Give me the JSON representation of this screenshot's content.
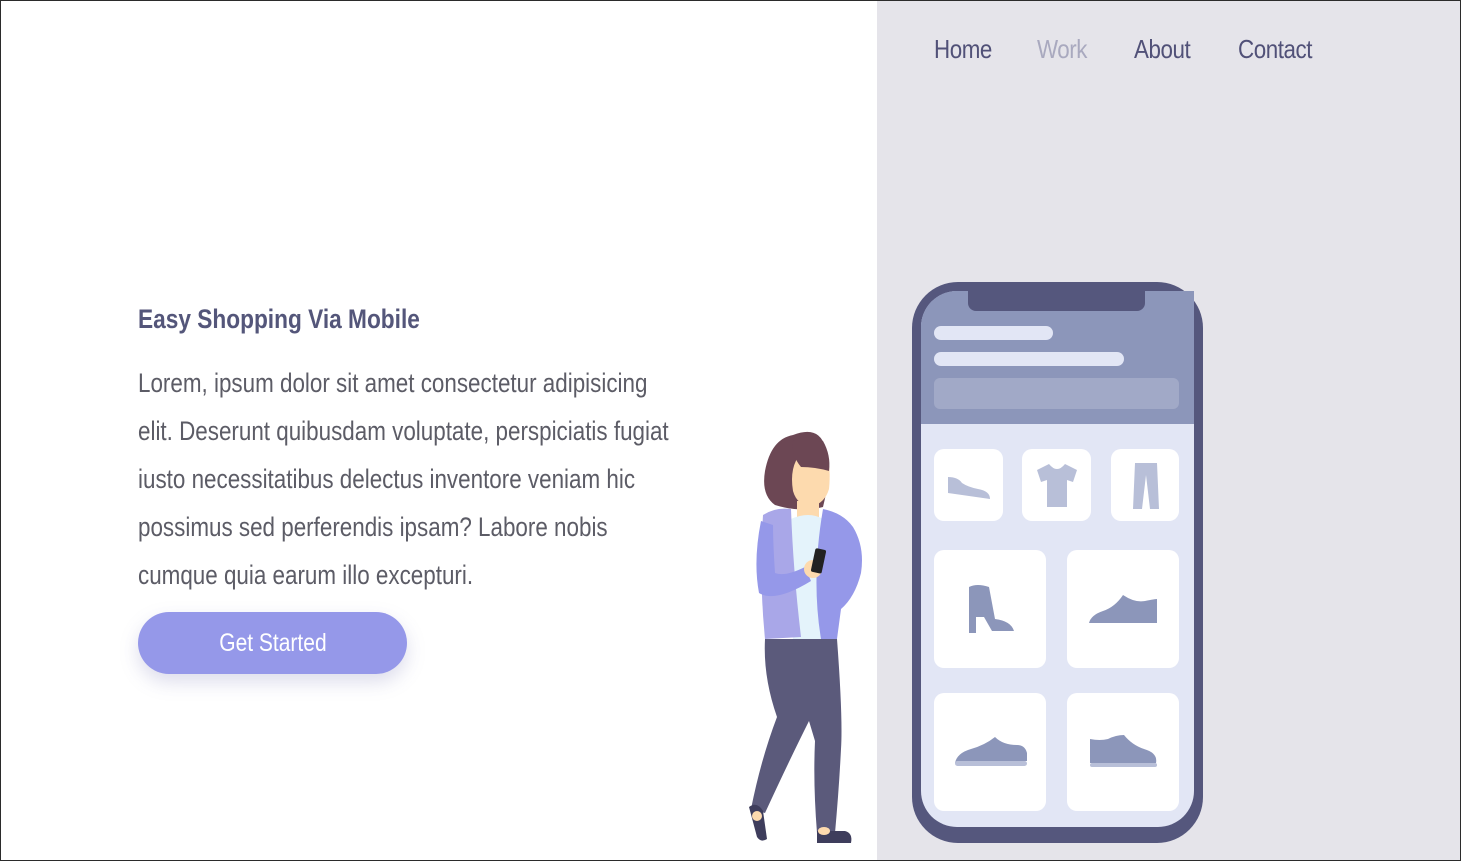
{
  "nav": {
    "items": [
      {
        "label": "Home",
        "active": false
      },
      {
        "label": "Work",
        "active": true
      },
      {
        "label": "About",
        "active": false
      },
      {
        "label": "Contact",
        "active": false
      }
    ]
  },
  "hero": {
    "title": "Easy Shopping Via Mobile",
    "body": "Lorem, ipsum dolor sit amet consectetur adipisicing elit. Deserunt quibusdam voluptate, perspiciatis fugiat iusto necessitatibus delectus inventore veniam hic possimus sed perferendis ipsam? Labore nobis cumque quia earum illo excepturi.",
    "cta_label": "Get Started"
  },
  "illustration": {
    "phone_icons": [
      "shoe-icon",
      "tshirt-icon",
      "pants-icon",
      "boot-icon",
      "sneaker-icon",
      "sneaker-icon",
      "sneaker-icon"
    ],
    "person": "woman-holding-phone"
  },
  "colors": {
    "accent": "#9598e9",
    "nav_text": "#515178",
    "nav_active": "#a9a9bf",
    "panel_bg": "#e5e4ea",
    "phone_frame": "#55577d",
    "phone_header": "#8c96ba",
    "phone_screen": "#e2e6f5"
  }
}
